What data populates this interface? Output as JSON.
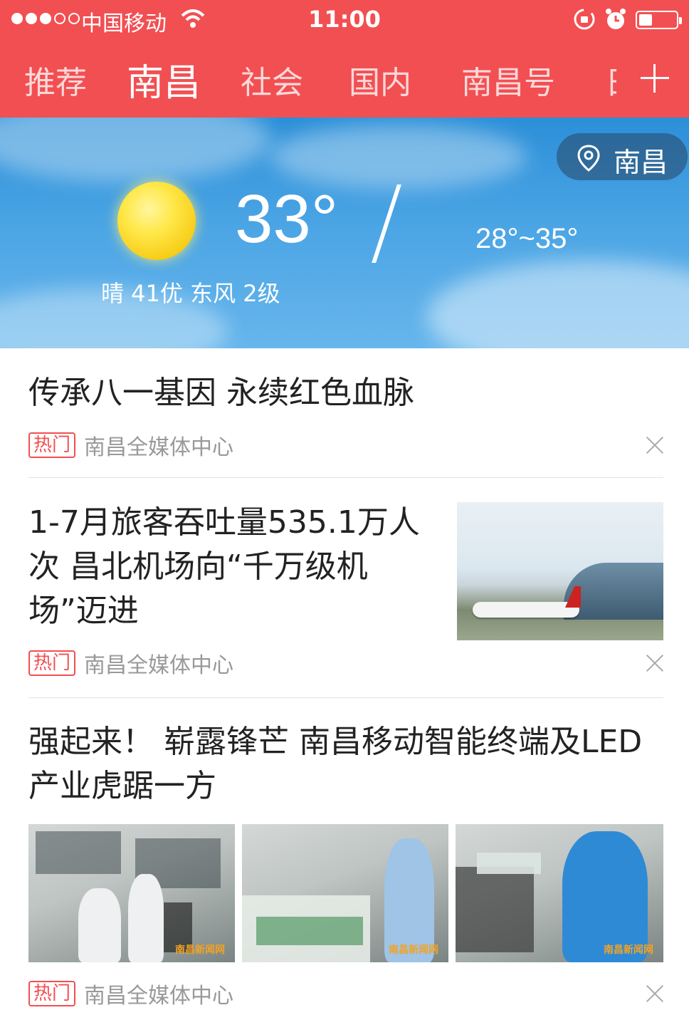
{
  "status_bar": {
    "carrier": "中国移动",
    "time": "11:00",
    "signal_bars_filled": 3,
    "signal_bars_total": 5
  },
  "nav_tabs": [
    {
      "label": "推荐",
      "active": false
    },
    {
      "label": "南昌",
      "active": true
    },
    {
      "label": "社会",
      "active": false
    },
    {
      "label": "国内",
      "active": false
    },
    {
      "label": "南昌号",
      "active": false
    },
    {
      "label": "日",
      "active": false
    }
  ],
  "weather": {
    "current_temp": "33°",
    "range": "28°~35°",
    "description": "晴 41优 东风 2级",
    "location": "南昌",
    "icon": "sun-icon"
  },
  "news": [
    {
      "title": "传承八一基因 永续红色血脉",
      "badge": "热门",
      "source": "南昌全媒体中心"
    },
    {
      "title": "1-7月旅客吞吐量535.1万人次 昌北机场向“千万级机场”迈进",
      "badge": "热门",
      "source": "南昌全媒体中心"
    },
    {
      "title": "强起来！ 崭露锋芒 南昌移动智能终端及LED产业虎踞一方",
      "badge": "热门",
      "source": "南昌全媒体中心",
      "image_watermark": "南昌新闻网"
    }
  ],
  "colors": {
    "brand_red": "#f24f52",
    "sky_blue": "#4aa4e4",
    "meta_gray": "#999999"
  }
}
